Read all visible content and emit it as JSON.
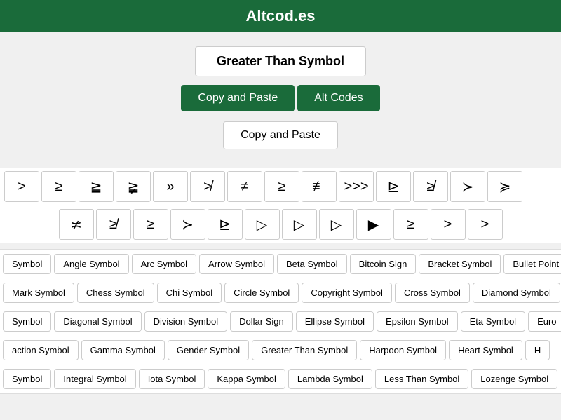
{
  "header": {
    "title": "Altcod.es"
  },
  "main": {
    "title_label": "Greater Than Symbol",
    "btn_copy_paste": "Copy and Paste",
    "btn_alt_codes": "Alt Codes",
    "subtitle_label": "Copy and Paste"
  },
  "symbols_row1": [
    ">",
    "≥",
    "≧",
    "≩",
    "»",
    "≯",
    "≠",
    "≥",
    "≢",
    ">>>",
    "⊵",
    "≱",
    "≻",
    "≽"
  ],
  "symbols_row2": [
    "≭",
    "≱",
    "≥",
    "≻",
    "⊵",
    "▷",
    "▷",
    "▷",
    "▶",
    "≥",
    ">",
    ">"
  ],
  "category_rows": [
    [
      "Symbol",
      "Angle Symbol",
      "Arc Symbol",
      "Arrow Symbol",
      "Beta Symbol",
      "Bitcoin Sign",
      "Bracket Symbol",
      "Bullet Point"
    ],
    [
      "Mark Symbol",
      "Chess Symbol",
      "Chi Symbol",
      "Circle Symbol",
      "Copyright Symbol",
      "Cross Symbol",
      "Diamond Symbol"
    ],
    [
      "Symbol",
      "Diagonal Symbol",
      "Division Symbol",
      "Dollar Sign",
      "Ellipse Symbol",
      "Epsilon Symbol",
      "Eta Symbol",
      "Euro"
    ],
    [
      "action Symbol",
      "Gamma Symbol",
      "Gender Symbol",
      "Greater Than Symbol",
      "Harpoon Symbol",
      "Heart Symbol",
      "H"
    ],
    [
      "Symbol",
      "Integral Symbol",
      "Iota Symbol",
      "Kappa Symbol",
      "Lambda Symbol",
      "Less Than Symbol",
      "Lozenge Symbol"
    ]
  ]
}
